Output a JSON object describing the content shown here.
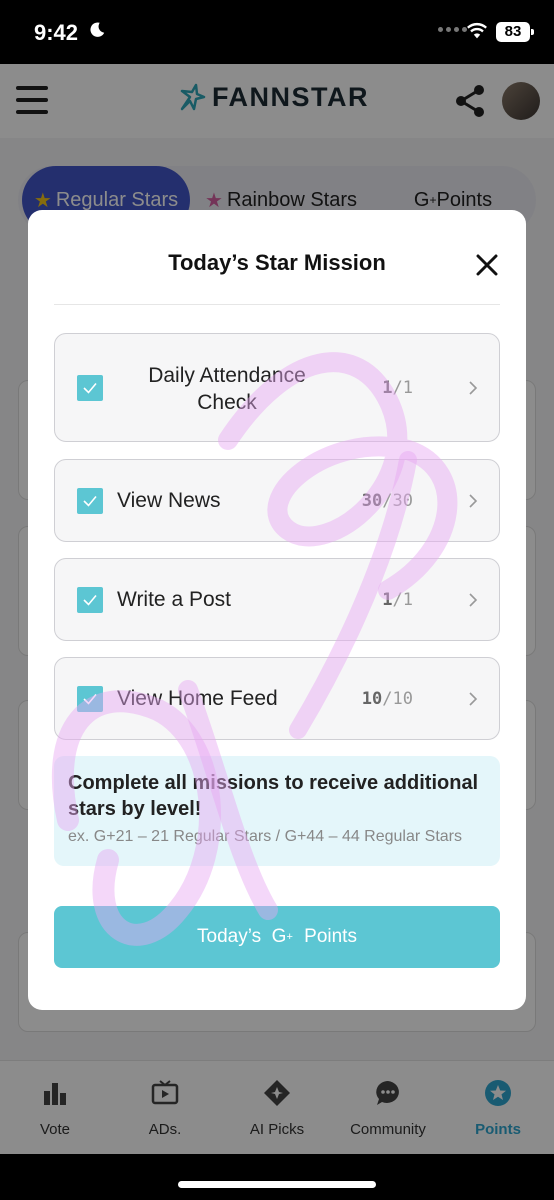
{
  "status": {
    "time": "9:42",
    "battery": "83"
  },
  "header": {
    "brand": "FANNSTAR"
  },
  "tabs": [
    {
      "label": "Regular Stars"
    },
    {
      "label": "Rainbow Stars"
    },
    {
      "label": "G",
      "sup": "+",
      "rest": " Points"
    }
  ],
  "modal": {
    "title": "Today’s Star Mission",
    "missions": [
      {
        "label": "Daily Attendance Check",
        "done": "1",
        "total": "/1"
      },
      {
        "label": "View News",
        "done": "30",
        "total": "/30"
      },
      {
        "label": "Write a Post",
        "done": "1",
        "total": "/1"
      },
      {
        "label": "View Home Feed",
        "done": "10",
        "total": "/10"
      }
    ],
    "bonus_title": "Complete all missions to receive additional stars by level!",
    "bonus_sub": "ex. G+21 – 21 Regular Stars / G+44 – 44 Regular Stars",
    "button": {
      "pre": "Today’s  G",
      "sup": "+",
      "post": " Points"
    }
  },
  "tabbar": [
    {
      "label": "Vote"
    },
    {
      "label": "ADs."
    },
    {
      "label": "AI Picks"
    },
    {
      "label": "Community"
    },
    {
      "label": "Points"
    }
  ],
  "colors": {
    "accent": "#5cc6d3",
    "active_tab": "#4356c9",
    "points_active": "#2fa7d0"
  }
}
